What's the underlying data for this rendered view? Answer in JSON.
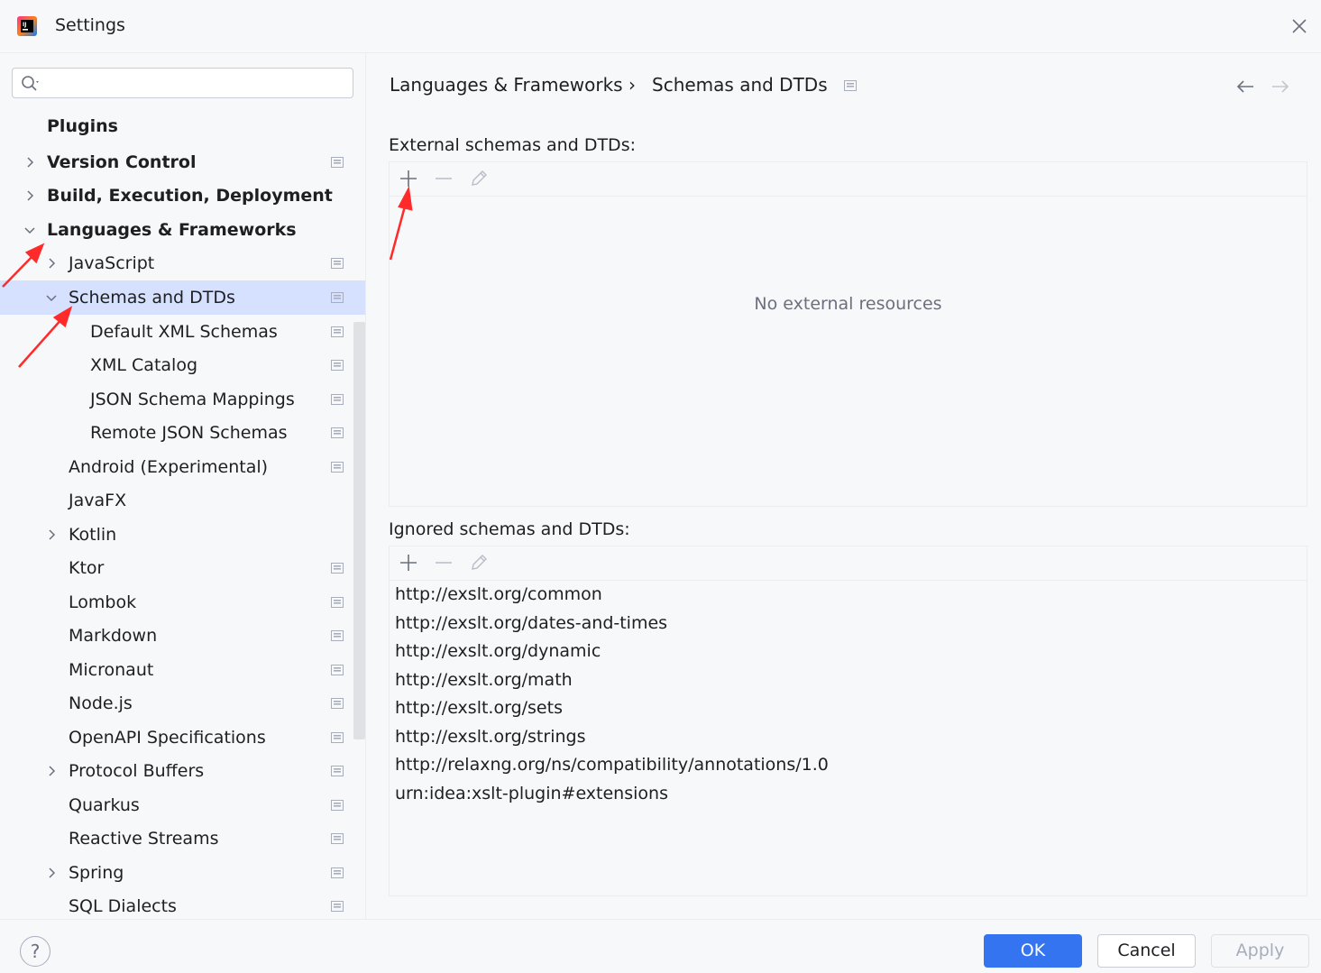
{
  "window": {
    "title": "Settings",
    "icons": {
      "logo": "intellij-logo-icon",
      "close": "close-icon"
    }
  },
  "search": {
    "placeholder": ""
  },
  "sidebar": {
    "items": [
      {
        "label": "Plugins",
        "bold": true,
        "chevron": "none",
        "has_project_icon": false
      },
      {
        "label": "Version Control",
        "bold": true,
        "chevron": "collapsed",
        "has_project_icon": true
      },
      {
        "label": "Build, Execution, Deployment",
        "bold": true,
        "chevron": "collapsed",
        "has_project_icon": false
      },
      {
        "label": "Languages & Frameworks",
        "bold": true,
        "chevron": "expanded",
        "has_project_icon": false
      },
      {
        "label": "JavaScript",
        "bold": false,
        "chevron": "collapsed",
        "has_project_icon": true
      },
      {
        "label": "Schemas and DTDs",
        "bold": false,
        "chevron": "expanded",
        "has_project_icon": true,
        "selected": true
      },
      {
        "label": "Default XML Schemas",
        "bold": false,
        "chevron": "none",
        "has_project_icon": true
      },
      {
        "label": "XML Catalog",
        "bold": false,
        "chevron": "none",
        "has_project_icon": true
      },
      {
        "label": "JSON Schema Mappings",
        "bold": false,
        "chevron": "none",
        "has_project_icon": true
      },
      {
        "label": "Remote JSON Schemas",
        "bold": false,
        "chevron": "none",
        "has_project_icon": true
      },
      {
        "label": "Android (Experimental)",
        "bold": false,
        "chevron": "none",
        "has_project_icon": true
      },
      {
        "label": "JavaFX",
        "bold": false,
        "chevron": "none",
        "has_project_icon": false
      },
      {
        "label": "Kotlin",
        "bold": false,
        "chevron": "collapsed",
        "has_project_icon": false
      },
      {
        "label": "Ktor",
        "bold": false,
        "chevron": "none",
        "has_project_icon": true
      },
      {
        "label": "Lombok",
        "bold": false,
        "chevron": "none",
        "has_project_icon": true
      },
      {
        "label": "Markdown",
        "bold": false,
        "chevron": "none",
        "has_project_icon": true
      },
      {
        "label": "Micronaut",
        "bold": false,
        "chevron": "none",
        "has_project_icon": true
      },
      {
        "label": "Node.js",
        "bold": false,
        "chevron": "none",
        "has_project_icon": true
      },
      {
        "label": "OpenAPI Specifications",
        "bold": false,
        "chevron": "none",
        "has_project_icon": true
      },
      {
        "label": "Protocol Buffers",
        "bold": false,
        "chevron": "collapsed",
        "has_project_icon": true
      },
      {
        "label": "Quarkus",
        "bold": false,
        "chevron": "none",
        "has_project_icon": true
      },
      {
        "label": "Reactive Streams",
        "bold": false,
        "chevron": "none",
        "has_project_icon": true
      },
      {
        "label": "Spring",
        "bold": false,
        "chevron": "collapsed",
        "has_project_icon": true
      },
      {
        "label": "SQL Dialects",
        "bold": false,
        "chevron": "none",
        "has_project_icon": true
      }
    ]
  },
  "breadcrumb": {
    "parent": "Languages & Frameworks",
    "separator": "›",
    "current": "Schemas and DTDs",
    "icons": {
      "back": "arrow-left-icon",
      "forward": "arrow-right-icon"
    }
  },
  "external": {
    "label": "External schemas and DTDs:",
    "empty_text": "No external resources",
    "toolbar": [
      "add-icon",
      "remove-icon",
      "edit-icon"
    ]
  },
  "ignored": {
    "label": "Ignored schemas and DTDs:",
    "toolbar": [
      "add-icon",
      "remove-icon",
      "edit-icon"
    ],
    "rows": [
      "http://exslt.org/common",
      "http://exslt.org/dates-and-times",
      "http://exslt.org/dynamic",
      "http://exslt.org/math",
      "http://exslt.org/sets",
      "http://exslt.org/strings",
      "http://relaxng.org/ns/compatibility/annotations/1.0",
      "urn:idea:xslt-plugin#extensions"
    ]
  },
  "footer": {
    "help": "?",
    "ok": "OK",
    "cancel": "Cancel",
    "apply": "Apply"
  },
  "colors": {
    "accent": "#3574f0",
    "selection": "#d5e1ff",
    "annotation_arrow": "#ff2a2a"
  }
}
